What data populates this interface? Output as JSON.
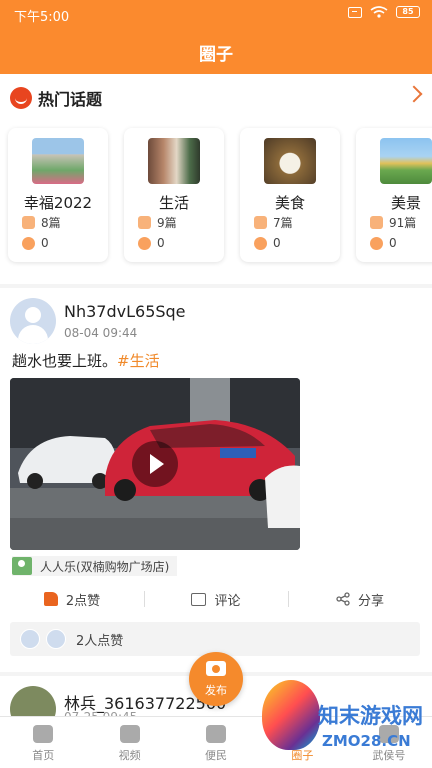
{
  "status": {
    "time": "下午5:00",
    "battery": "85"
  },
  "header": {
    "title": "圈子"
  },
  "hot_topics": {
    "title": "热门话题",
    "cards": [
      {
        "name": "幸福2022",
        "posts": "8篇",
        "likes": "0"
      },
      {
        "name": "生活",
        "posts": "9篇",
        "likes": "0"
      },
      {
        "name": "美食",
        "posts": "7篇",
        "likes": "0"
      },
      {
        "name": "美景",
        "posts": "91篇",
        "likes": "0"
      }
    ]
  },
  "post": {
    "username": "Nh37dvL65Sqe",
    "time": "08-04 09:44",
    "text": "趟水也要上班。",
    "tag": "#生活",
    "location": "人人乐(双楠购物广场店)",
    "actions": {
      "like": "2点赞",
      "comment": "评论",
      "share": "分享"
    },
    "likes_summary": "2人点赞"
  },
  "post2": {
    "username": "林兵_361637722560",
    "time": "07-25 09:45"
  },
  "fab": {
    "label": "发布"
  },
  "nav": [
    {
      "label": "首页",
      "icon": "home-icon"
    },
    {
      "label": "视频",
      "icon": "video-icon"
    },
    {
      "label": "便民",
      "icon": "heart-icon"
    },
    {
      "label": "圈子",
      "icon": "circle-icon"
    },
    {
      "label": "武侯号",
      "icon": "shop-icon"
    }
  ],
  "watermark": {
    "text": "知末游戏网",
    "sub": "ZMO28.CN"
  }
}
